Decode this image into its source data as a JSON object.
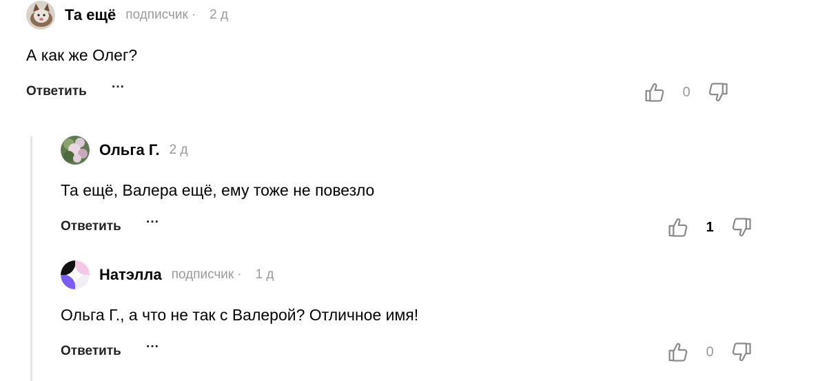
{
  "comments": [
    {
      "author": "Та ещё",
      "badge": "подписчик",
      "separator": "·",
      "time": "2 д",
      "text": "А как же Олег?",
      "reply_label": "Ответить",
      "more_label": "···",
      "likes": "0"
    },
    {
      "author": "Ольга Г.",
      "time": "2 д",
      "text": "Та ещё, Валера ещё, ему тоже не повезло",
      "reply_label": "Ответить",
      "more_label": "···",
      "likes": "1"
    },
    {
      "author": "Натэлла",
      "badge": "подписчик",
      "separator": "·",
      "time": "1 д",
      "text": "Ольга Г., а что не так с Валерой? Отличное имя!",
      "reply_label": "Ответить",
      "more_label": "···",
      "likes": "0"
    }
  ],
  "icons": {
    "like": "thumb-up-icon",
    "dislike": "thumb-down-icon"
  },
  "colors": {
    "muted": "#9a9a9a",
    "thread_line": "#e4e4e4",
    "icon_stroke": "#8a8a8a"
  }
}
